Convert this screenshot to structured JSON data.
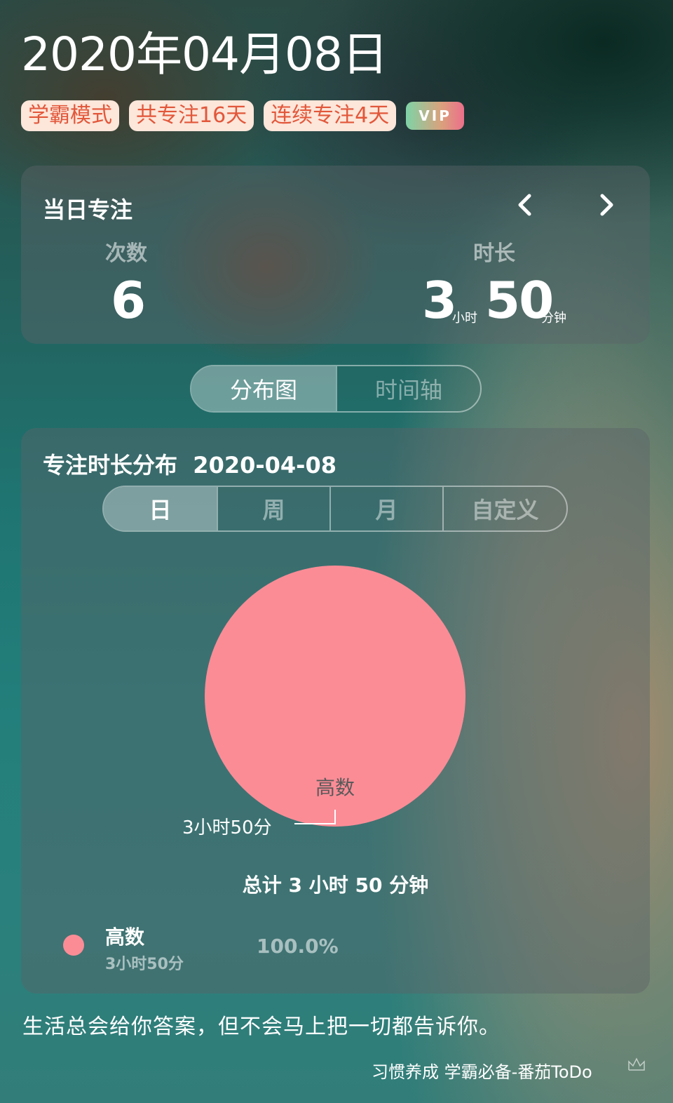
{
  "header": {
    "date": "2020年04月08日",
    "badges": [
      "学霸模式",
      "共专注16天",
      "连续专注4天"
    ],
    "vip_label": "VIP"
  },
  "day_focus": {
    "title": "当日专注",
    "count_label": "次数",
    "count_value": "6",
    "duration_label": "时长",
    "hours_value": "3",
    "hours_unit": "小时",
    "minutes_value": "50",
    "minutes_unit": "分钟"
  },
  "view_tabs": [
    "分布图",
    "时间轴"
  ],
  "distribution": {
    "title": "专注时长分布",
    "date": "2020-04-08",
    "range_tabs": [
      "日",
      "周",
      "月",
      "自定义"
    ],
    "total_text": "总计 3 小时 50 分钟",
    "legend": {
      "name": "高数",
      "duration": "3小时50分",
      "percent": "100.0%"
    }
  },
  "chart_data": {
    "type": "pie",
    "categories": [
      "高数"
    ],
    "values": [
      100.0
    ],
    "labels": [
      "3小时50分"
    ],
    "colors": [
      "#fb8c96"
    ]
  },
  "quote": "生活总会给你答案，但不会马上把一切都告诉你。",
  "footer": "习惯养成 学霸必备-番茄ToDo",
  "icons": {
    "prev": "chevron-left-icon",
    "next": "chevron-right-icon",
    "brand": "crown-icon"
  }
}
